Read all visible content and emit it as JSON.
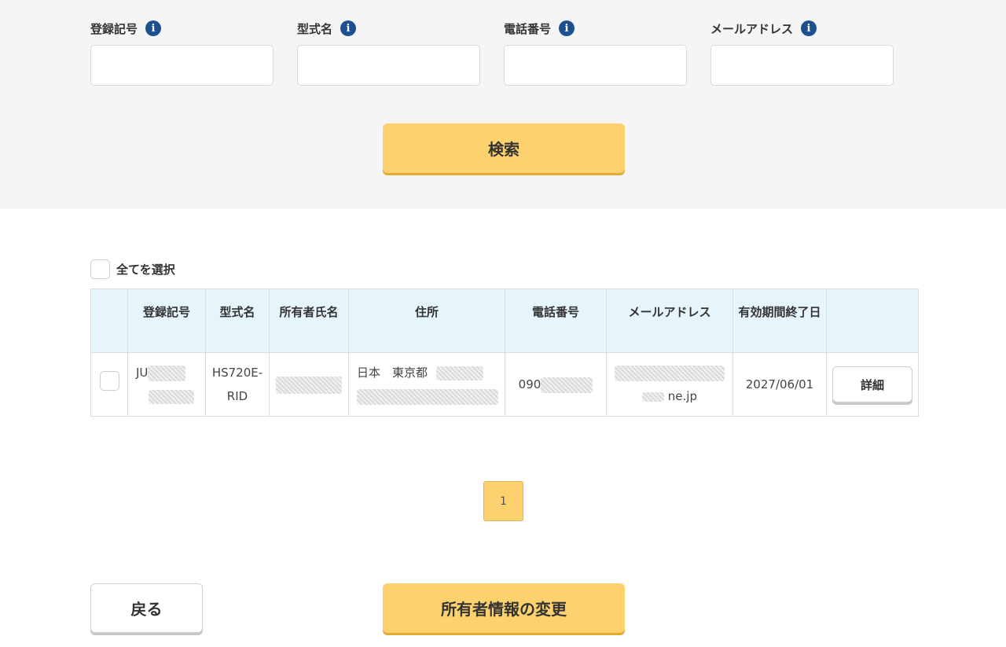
{
  "search": {
    "fields": [
      {
        "label": "登録記号",
        "value": ""
      },
      {
        "label": "型式名",
        "value": ""
      },
      {
        "label": "電話番号",
        "value": ""
      },
      {
        "label": "メールアドレス",
        "value": ""
      }
    ],
    "info_glyph": "i",
    "button_label": "検索"
  },
  "results": {
    "select_all_label": "全てを選択",
    "columns": [
      "",
      "登録記号",
      "型式名",
      "所有者氏名",
      "住所",
      "電話番号",
      "メールアドレス",
      "有効期間終了日",
      ""
    ],
    "rows": [
      {
        "registration_visible": "JU",
        "model": "HS720E-RID",
        "owner": "",
        "address_visible": "日本　東京都",
        "phone_visible": "090",
        "email_visible": "ne.jp",
        "expiry": "2027/06/01",
        "detail_label": "詳細"
      }
    ]
  },
  "pagination": {
    "current": "1"
  },
  "footer": {
    "back_label": "戻る",
    "change_label": "所有者情報の変更"
  },
  "colors": {
    "accent": "#fdd26e",
    "info": "#1e4f8f",
    "header_bg": "#e6f4fb",
    "panel_bg": "#f5f5f5"
  }
}
